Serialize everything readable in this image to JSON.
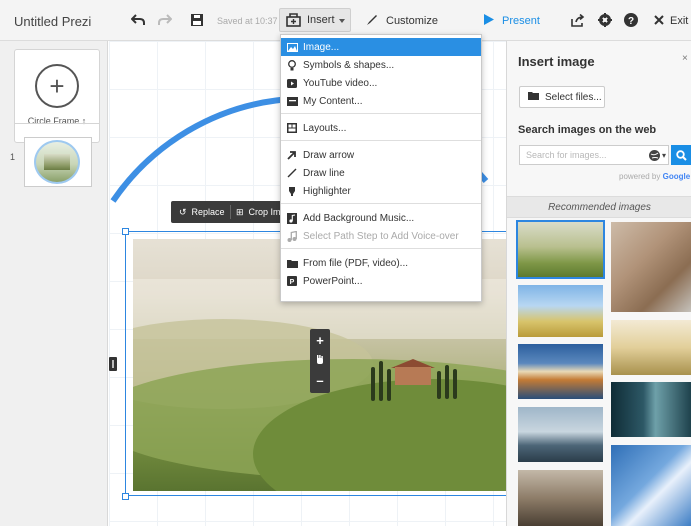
{
  "app": {
    "title": "Untitled Prezi",
    "saved_status": "Saved at 10:37"
  },
  "toolbar": {
    "undo_icon": "undo-arrow-icon",
    "redo_icon": "redo-arrow-icon",
    "save_icon": "floppy-disk-icon",
    "insert_label": "Insert",
    "customize_label": "Customize",
    "present_label": "Present",
    "share_icon": "share-icon",
    "settings_icon": "gear-icon",
    "help_icon": "help-icon",
    "exit_label": "Exit"
  },
  "sidebar": {
    "frame_type_label": "Circle Frame",
    "slides": [
      {
        "number": "1"
      }
    ]
  },
  "image_toolbar": {
    "replace_label": "Replace",
    "crop_label": "Crop Im"
  },
  "insert_menu": {
    "groups": [
      [
        {
          "label": "Image...",
          "icon": "image-icon",
          "active": true
        },
        {
          "label": "Symbols & shapes...",
          "icon": "bulb-icon"
        },
        {
          "label": "YouTube video...",
          "icon": "play-icon"
        },
        {
          "label": "My Content...",
          "icon": "folder-icon"
        }
      ],
      [
        {
          "label": "Layouts...",
          "icon": "layout-icon"
        }
      ],
      [
        {
          "label": "Draw arrow",
          "icon": "arrow-icon"
        },
        {
          "label": "Draw line",
          "icon": "line-icon"
        },
        {
          "label": "Highlighter",
          "icon": "highlighter-icon"
        }
      ],
      [
        {
          "label": "Add Background Music...",
          "icon": "music-file-icon"
        },
        {
          "label": "Select Path Step to Add Voice-over",
          "icon": "music-note-icon",
          "disabled": true
        }
      ],
      [
        {
          "label": "From file (PDF, video)...",
          "icon": "file-folder-icon"
        },
        {
          "label": "PowerPoint...",
          "icon": "powerpoint-icon"
        }
      ]
    ]
  },
  "insert_panel": {
    "title": "Insert image",
    "close_glyph": "×",
    "select_files_label": "Select files...",
    "search_title": "Search images on the web",
    "search_placeholder": "Search for images...",
    "powered_by": "powered by",
    "powered_brand": "Google",
    "recommended_label": "Recommended images"
  },
  "colors": {
    "accent_blue": "#2d86e0",
    "present_blue": "#1a8ee5",
    "menu_highlight": "#2a8fe3",
    "frame_arc": "#3d8fe4"
  }
}
